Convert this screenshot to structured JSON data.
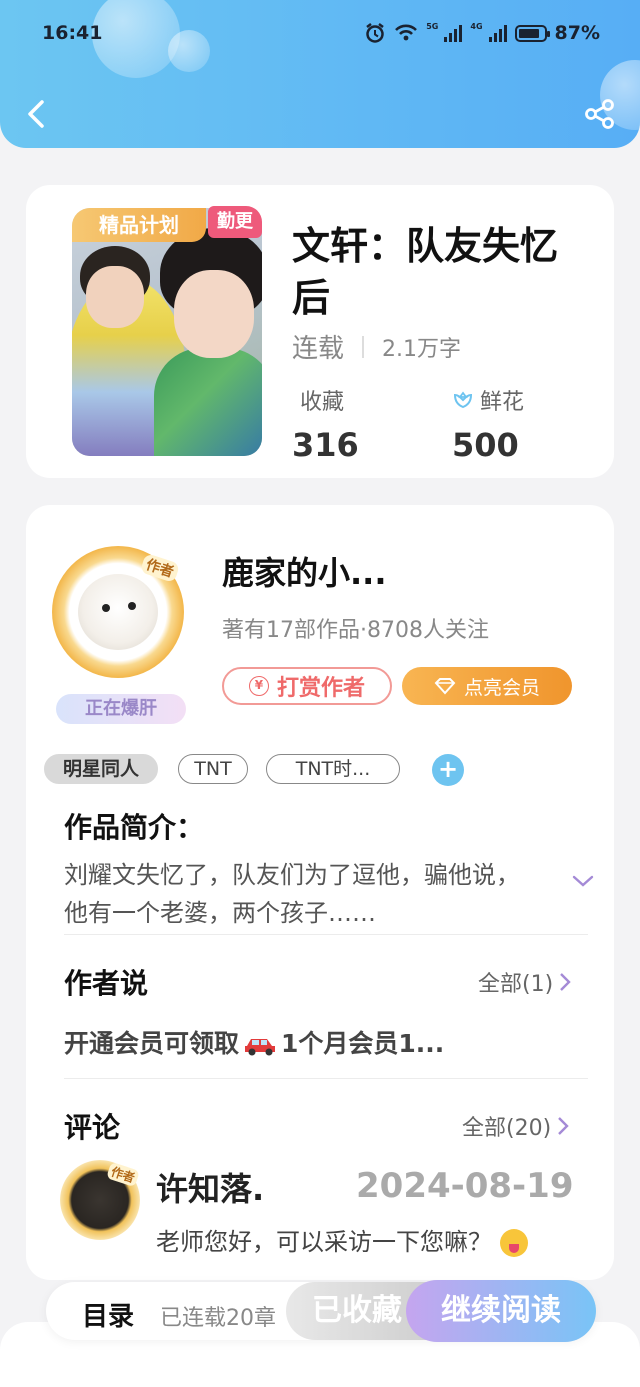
{
  "status_bar": {
    "time": "16:41",
    "net1": "5G",
    "net2": "4G",
    "battery": "87%",
    "battery_level": 0.87
  },
  "header": {
    "back_icon": "chevron-left-icon",
    "share_icon": "share-icon"
  },
  "book": {
    "tag_plan": "精品计划",
    "tag_update": "勤更",
    "title": "文轩：队友失忆后",
    "status": "连载",
    "word_count": "2.1万字",
    "fav_label": "收藏",
    "fav_count": "316",
    "flower_label": "鲜花",
    "flower_count": "500"
  },
  "author": {
    "avatar_tag": "作者",
    "badge": "正在爆肝",
    "name": "鹿家的小...",
    "meta": "著有17部作品·8708人关注",
    "tip_label": "打赏作者",
    "tip_symbol": "¥",
    "vip_label": "点亮会员"
  },
  "tags": [
    "明星同人",
    "TNT",
    "TNT时..."
  ],
  "intro": {
    "title": "作品简介：",
    "line1": "刘耀文失忆了，队友们为了逗他，骗他说，",
    "line2": "他有一个老婆，两个孩子……"
  },
  "author_say": {
    "title": "作者说",
    "all": "全部(1)",
    "text_a": "开通会员可领取",
    "text_b": "1个月会员1..."
  },
  "comments": {
    "title": "评论",
    "all": "全部(20)",
    "avatar_tag": "作者",
    "user": "许知落.",
    "date": "2024-08-19",
    "text": "老师您好，可以采访一下您嘛？"
  },
  "bottom": {
    "toc": "目录",
    "serial": "已连载20章",
    "fav_button": "已收藏",
    "read_button": "继续阅读"
  },
  "colors": {
    "header_start": "#6cc6f2",
    "header_end": "#57aef5",
    "accent_orange": "#f0952d",
    "tip_red": "#ef6a6a",
    "read_start": "#c5a5ef",
    "read_end": "#79c4f6"
  }
}
